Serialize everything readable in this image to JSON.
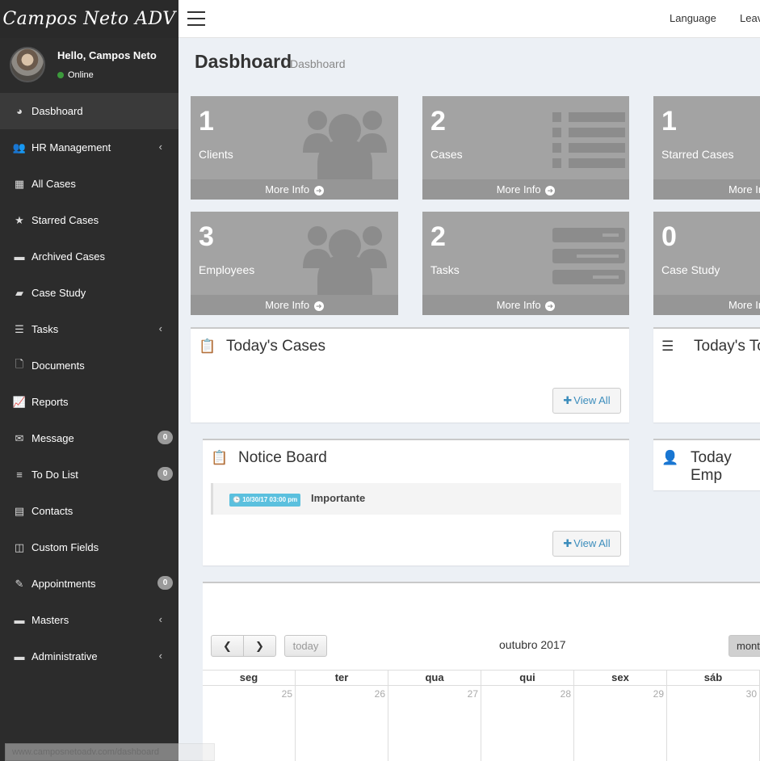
{
  "brand": {
    "name": "Campos Neto ADV"
  },
  "user": {
    "greeting": "Hello, Campos Neto",
    "status": "Online"
  },
  "sidebar": {
    "items": [
      {
        "label": "Dasbhoard",
        "icon": "dashboard-icon",
        "glyph": "◕",
        "caret": false,
        "badge": ""
      },
      {
        "label": "HR Management",
        "icon": "users-icon",
        "glyph": "👥",
        "caret": true,
        "badge": ""
      },
      {
        "label": "All Cases",
        "icon": "grid-icon",
        "glyph": "▦",
        "caret": false,
        "badge": ""
      },
      {
        "label": "Starred Cases",
        "icon": "star-icon",
        "glyph": "★",
        "caret": false,
        "badge": ""
      },
      {
        "label": "Archived Cases",
        "icon": "archive-icon",
        "glyph": "▬",
        "caret": false,
        "badge": ""
      },
      {
        "label": "Case Study",
        "icon": "book-icon",
        "glyph": "▰",
        "caret": false,
        "badge": ""
      },
      {
        "label": "Tasks",
        "icon": "tasks-icon",
        "glyph": "☰",
        "caret": true,
        "badge": ""
      },
      {
        "label": "Documents",
        "icon": "file-icon",
        "glyph": "🗋",
        "caret": false,
        "badge": ""
      },
      {
        "label": "Reports",
        "icon": "line-chart-icon",
        "glyph": "📈",
        "caret": false,
        "badge": ""
      },
      {
        "label": "Message",
        "icon": "envelope-icon",
        "glyph": "✉",
        "caret": false,
        "badge": "0"
      },
      {
        "label": "To Do List",
        "icon": "list-icon",
        "glyph": "≡",
        "caret": false,
        "badge": "0"
      },
      {
        "label": "Contacts",
        "icon": "contact-card-icon",
        "glyph": "▤",
        "caret": false,
        "badge": ""
      },
      {
        "label": "Custom Fields",
        "icon": "columns-icon",
        "glyph": "◫",
        "caret": false,
        "badge": ""
      },
      {
        "label": "Appointments",
        "icon": "pin-icon",
        "glyph": "✎",
        "caret": false,
        "badge": "0"
      },
      {
        "label": "Masters",
        "icon": "folder-icon",
        "glyph": "▬",
        "caret": true,
        "badge": ""
      },
      {
        "label": "Administrative",
        "icon": "folder-icon",
        "glyph": "▬",
        "caret": true,
        "badge": ""
      }
    ]
  },
  "topbar": {
    "language": "Language",
    "leave": "Leav"
  },
  "page": {
    "title": "Dasbhoard",
    "breadcrumb": "Dasbhoard"
  },
  "stats": [
    {
      "value": "1",
      "label": "Clients",
      "footer": "More Info",
      "icon": "users-icon"
    },
    {
      "value": "2",
      "label": "Cases",
      "footer": "More Info",
      "icon": "list-icon"
    },
    {
      "value": "1",
      "label": "Starred Cases",
      "footer": "More In",
      "icon": "star-icon"
    },
    {
      "value": "3",
      "label": "Employees",
      "footer": "More Info",
      "icon": "users-icon"
    },
    {
      "value": "2",
      "label": "Tasks",
      "footer": "More Info",
      "icon": "tasks-icon"
    },
    {
      "value": "0",
      "label": "Case Study",
      "footer": "More In",
      "icon": "book-icon"
    }
  ],
  "panels": {
    "today_cases": {
      "title": "Today's Cases",
      "button": "View All"
    },
    "today_tasks": {
      "title": "Today's To"
    },
    "notice_board": {
      "title": "Notice Board",
      "button": "View All",
      "notice_time": "10/30/17 03:00 pm",
      "notice_text": "Importante"
    },
    "today_employees": {
      "title": "Today Emp"
    }
  },
  "calendar": {
    "title": "outubro 2017",
    "today_label": "today",
    "view_label": "mont",
    "days": [
      "seg",
      "ter",
      "qua",
      "qui",
      "sex",
      "sáb"
    ],
    "dates": [
      "25",
      "26",
      "27",
      "28",
      "29",
      "30"
    ]
  },
  "status_bar": {
    "url": "www.camposnetoadv.com/dashboard"
  }
}
